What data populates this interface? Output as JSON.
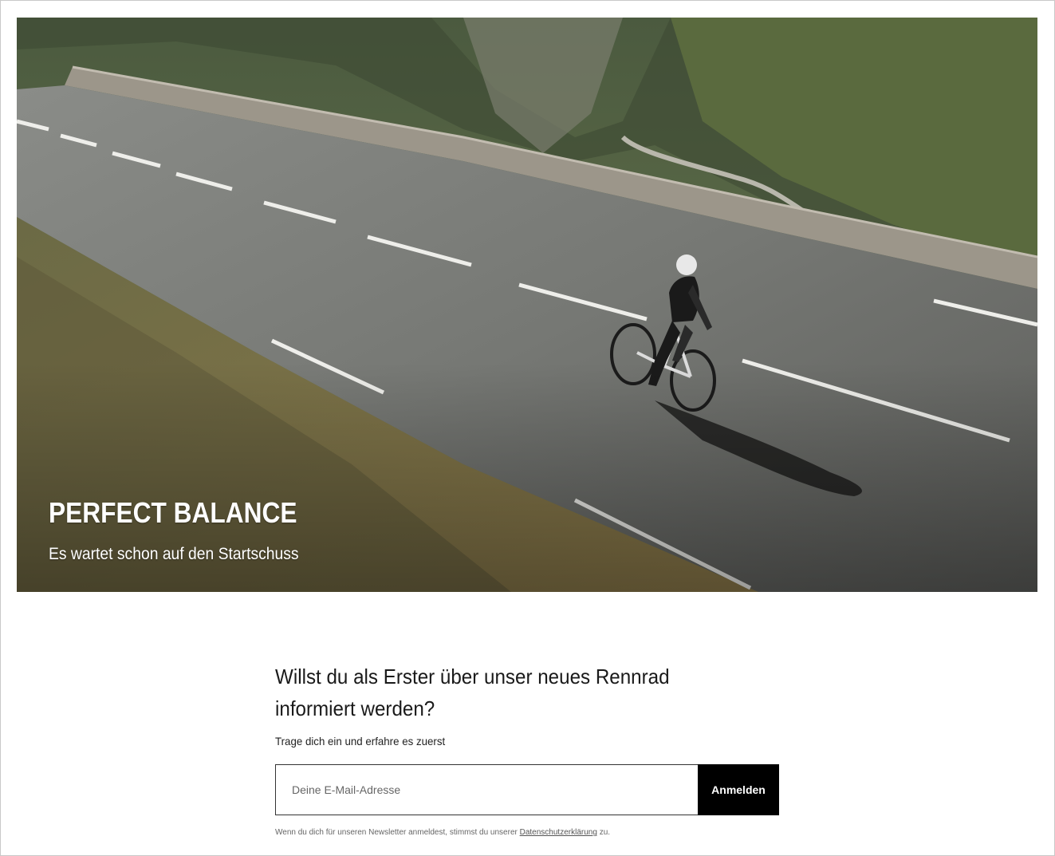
{
  "hero": {
    "title": "PERFECT BALANCE",
    "subtitle": "Es wartet schon auf den Startschuss",
    "image_icon": "cyclist-on-mountain-road-photo"
  },
  "newsletter": {
    "heading": "Willst du als Erster über unser neues Rennrad informiert werden?",
    "subheading": "Trage dich ein und erfahre es zuerst",
    "email_placeholder": "Deine E-Mail-Adresse",
    "email_value": "",
    "submit_label": "Anmelden",
    "legal_prefix": "Wenn du dich für unseren Newsletter anmeldest, stimmst du unserer",
    "legal_link": "Datenschutzerklärung",
    "legal_suffix": "zu."
  },
  "colors": {
    "button_bg": "#000000",
    "button_text": "#ffffff",
    "hero_text": "#ffffff",
    "page_bg": "#ffffff"
  }
}
